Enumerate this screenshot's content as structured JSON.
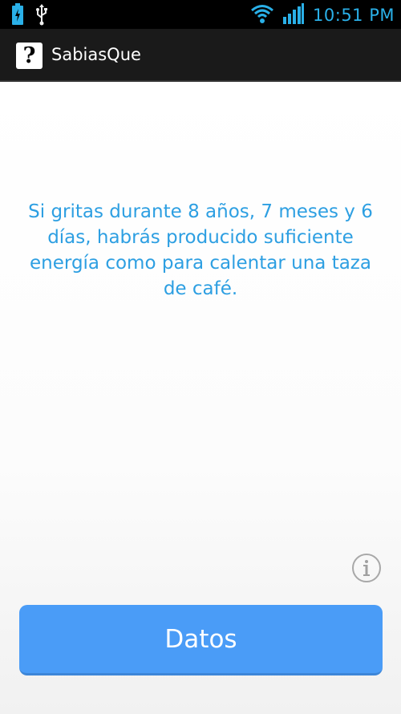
{
  "status_bar": {
    "time": "10:51 PM",
    "icons": [
      "battery-charging-icon",
      "usb-icon",
      "wifi-icon",
      "signal-icon"
    ],
    "color": "#2ab0e8"
  },
  "action_bar": {
    "app_icon_glyph": "?",
    "title": "SabiasQue"
  },
  "main": {
    "fact": "Si gritas durante 8 años, 7 meses y 6 días, habrás producido suficiente energía como para calentar una taza de café.",
    "fact_color": "#2d9fe2",
    "info_icon": "info-icon",
    "button_label": "Datos",
    "button_color": "#4a9cf7"
  }
}
